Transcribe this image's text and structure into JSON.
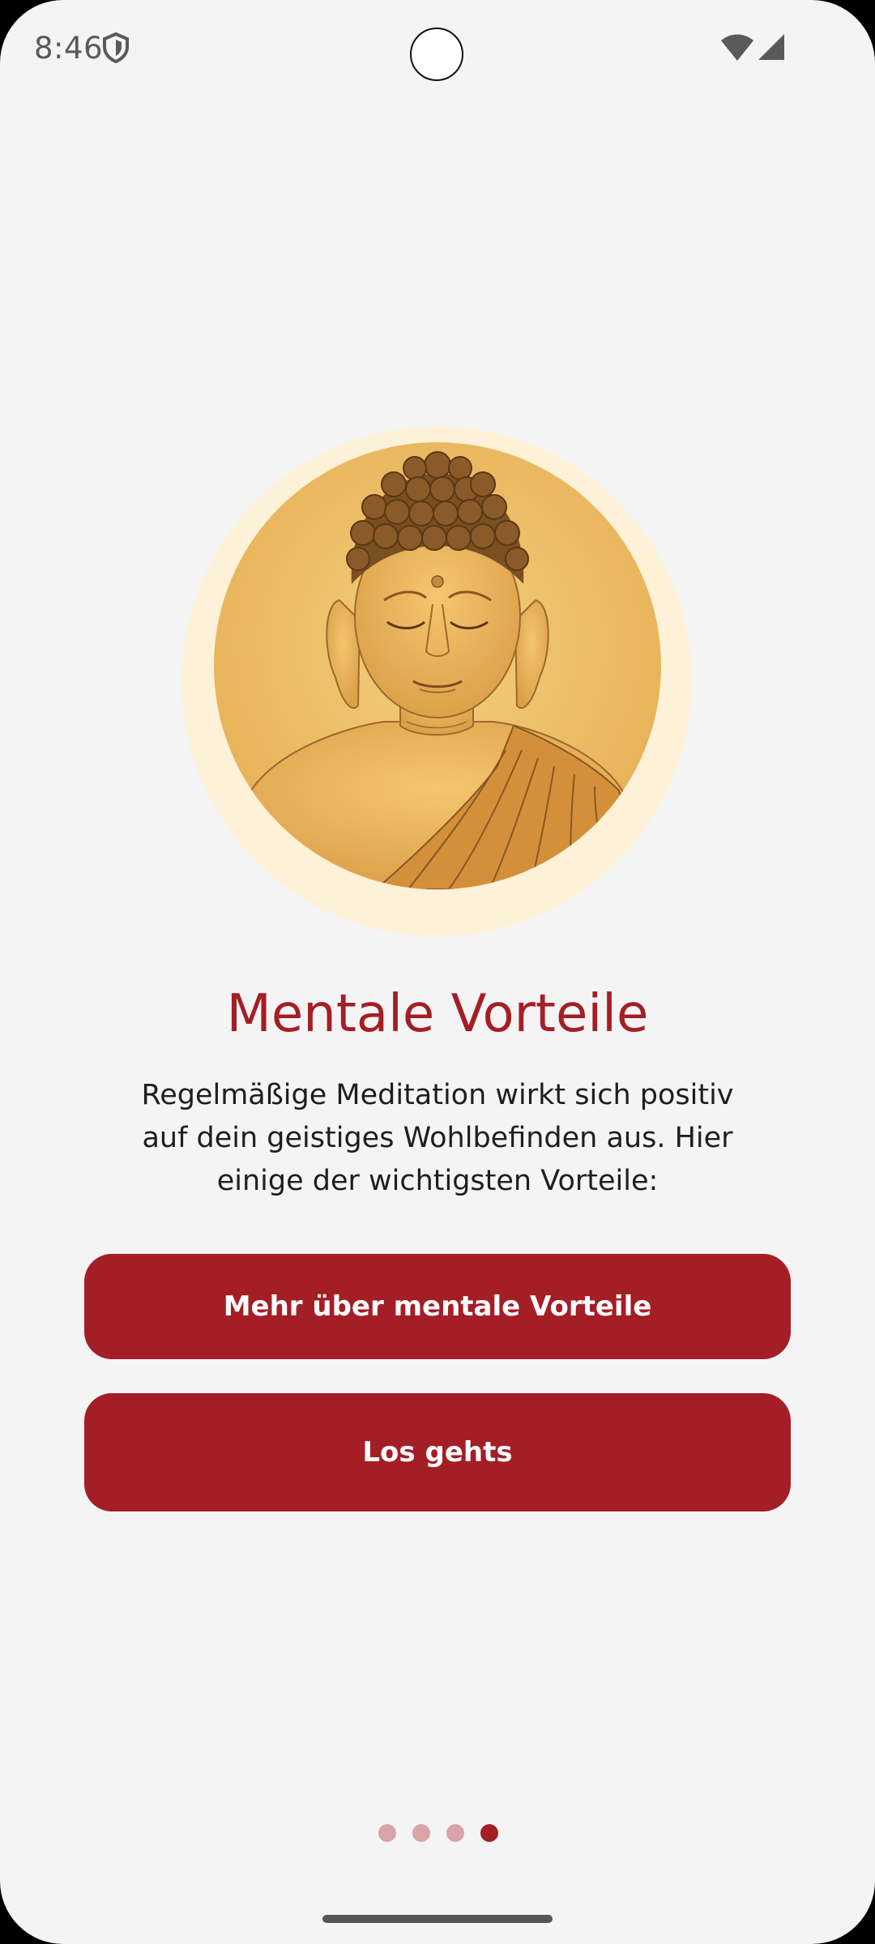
{
  "status_bar": {
    "time": "8:46",
    "icons": [
      "shield-icon",
      "wifi-icon",
      "signal-icon"
    ]
  },
  "hero": {
    "image": "buddha-illustration"
  },
  "title": "Mentale Vorteile",
  "body": "Regelmäßige Meditation wirkt sich positiv auf dein geistiges Wohlbefinden aus. Hier einige der wichtigsten Vorteile:",
  "buttons": {
    "more": "Mehr über mentale Vorteile",
    "start": "Los gehts"
  },
  "pager": {
    "total": 4,
    "active": 4
  },
  "colors": {
    "accent": "#a41e26",
    "background": "#f4f4f4",
    "halo": "#fdf1d8",
    "dot_inactive": "#d9a3a7"
  }
}
